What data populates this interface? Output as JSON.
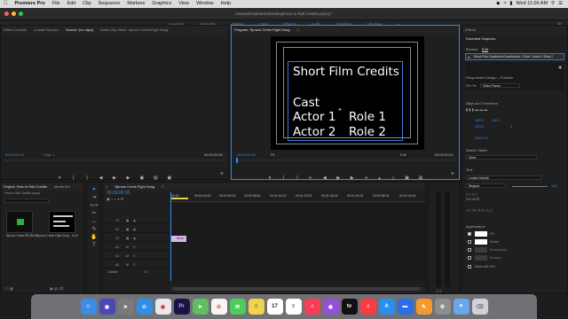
{
  "menubar": {
    "items": [
      "Premiere Pro",
      "File",
      "Edit",
      "Clip",
      "Sequence",
      "Markers",
      "Graphics",
      "View",
      "Window",
      "Help"
    ],
    "clock": "Wed 11:06 AM"
  },
  "titlebar": {
    "path": "/Users/ericalvarez/Desktop/How to Roll Credits.prproj *"
  },
  "workspaces": [
    "Learning",
    "Assembly",
    "Editing",
    "Color",
    "Effects",
    "Audio",
    "Graphics",
    "Libraries"
  ],
  "workspaces_active": "Effects",
  "source_panel": {
    "tabs": [
      "Effect Controls",
      "Lumetri Scopes",
      "Source: (no clips)",
      "Audio Clip Mixer: Spruce Creek Fight Song"
    ],
    "timecode_left": "00;00;00;00",
    "timecode_right": "00;00;00;00",
    "page": "Page 1"
  },
  "program_panel": {
    "title": "Program: Spruce Creek Fight Song",
    "timecode": "00;00;00;00",
    "fit": "Fit",
    "quality": "Full",
    "end_timecode": "00;00;00;01",
    "credits": {
      "heading": "Short Film Credits",
      "section": "Cast",
      "rows": [
        {
          "actor": "Actor 1",
          "role": "Role 1"
        },
        {
          "actor": "Actor 2",
          "role": "Role 2"
        }
      ]
    }
  },
  "project_panel": {
    "tabs": [
      "Project: How to Roll Credits",
      "Media Bro"
    ],
    "file": "How to Roll Credits.prproj",
    "items": [
      {
        "name": "Spruce Creek F...",
        "duration": "37;08;00"
      },
      {
        "name": "Spruce Creek Fight Song",
        "duration": "6;18"
      }
    ]
  },
  "timeline_panel": {
    "tab": "Spruce Creek Fight Song",
    "timecode": "00;00;00;00",
    "ruler": [
      "00;00",
      "00;00;16;00",
      "00;00;32;00",
      "00;00;48;00",
      "00;01;04;02",
      "00;01;20;02",
      "00;01;36;02",
      "00;01;52;02",
      "00;02;08;04",
      "00;02;24;04"
    ],
    "video_tracks": [
      "V3",
      "V2",
      "V1"
    ],
    "audio_tracks": [
      "A1",
      "A2",
      "A3"
    ],
    "master_label": "Master",
    "master_value": "0.0",
    "clip_label": "Short"
  },
  "essential_graphics": {
    "panel_title": "Effects",
    "tab": "Essential Graphics",
    "subtabs": [
      "Browse",
      "Edit"
    ],
    "layer_label": "Short Film Credits\\n\\nCast\\nActor 1 Role 1 Actor 2 Role 2",
    "responsive_design_label": "Responsive Design – Position",
    "pin_to_label": "Pin To:",
    "pin_to_value": "Video Frame",
    "align_transform_label": "Align and Transform",
    "position_x": "189.3",
    "position_y": "66.0",
    "scale_value": "100.0",
    "rotation_value": "0",
    "opacity_value": "100.0 %",
    "master_styles_label": "Master Styles",
    "master_styles_value": "None",
    "text_label": "Text",
    "font_value": "Lucida Grande",
    "font_style": "Regular",
    "font_size": "100",
    "appearance_label": "Appearance",
    "fill_label": "Fill",
    "stroke_label": "Stroke",
    "background_label": "Background",
    "shadow_label": "Shadow",
    "mask_label": "Mask with Text"
  },
  "dock": {
    "apps": [
      "Finder",
      "Siri",
      "Launchpad",
      "Safari",
      "Chrome",
      "Premiere Pro",
      "Maps",
      "Photos",
      "Messages",
      "Notes",
      "Calendar",
      "Reminders",
      "Music",
      "Podcasts",
      "TV",
      "Music2",
      "App Store",
      "Keynote",
      "Pages",
      "Preferences",
      "Folder",
      "Trash"
    ],
    "calendar_day": "17",
    "tv_label": "tv"
  },
  "colors": {
    "accent": "#2d8ceb",
    "clip": "#d8b6e3",
    "playhead": "#2d8ceb",
    "background": "#1d1d1d"
  }
}
